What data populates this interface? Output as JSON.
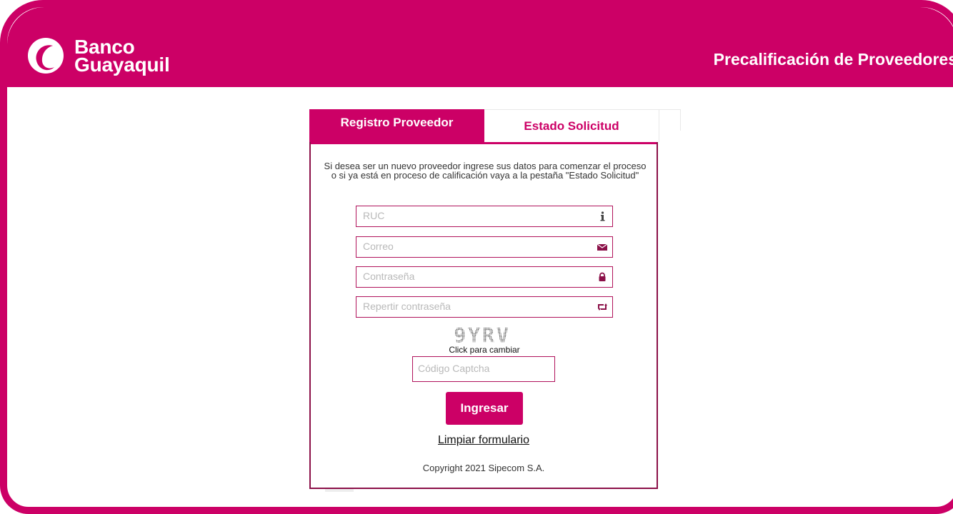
{
  "header": {
    "brand_line1": "Banco",
    "brand_line2": "Guayaquil",
    "title": "Precalificación de Proveedores"
  },
  "tabs": [
    {
      "label": "Registro Proveedor",
      "active": true
    },
    {
      "label": "Estado Solicitud",
      "active": false
    }
  ],
  "form": {
    "intro": "Si desea ser un nuevo proveedor ingrese sus datos para comenzar el proceso o si ya está en proceso de calificación vaya a la pestaña \"Estado Solicitud\"",
    "fields": [
      {
        "placeholder": "RUC",
        "icon": "info-icon"
      },
      {
        "placeholder": "Correo",
        "icon": "envelope-icon"
      },
      {
        "placeholder": "Contraseña",
        "icon": "lock-icon"
      },
      {
        "placeholder": "Repertir contraseña",
        "icon": "retweet-icon"
      }
    ],
    "captcha_text": "9YRV",
    "captcha_hint": "Click para cambiar",
    "captcha_placeholder": "Código Captcha",
    "submit_label": "Ingresar",
    "clear_label": "Limpiar formulario",
    "copyright": "Copyright 2021 Sipecom S.A."
  },
  "colors": {
    "brand": "#cc0066",
    "border": "#8b1048"
  }
}
